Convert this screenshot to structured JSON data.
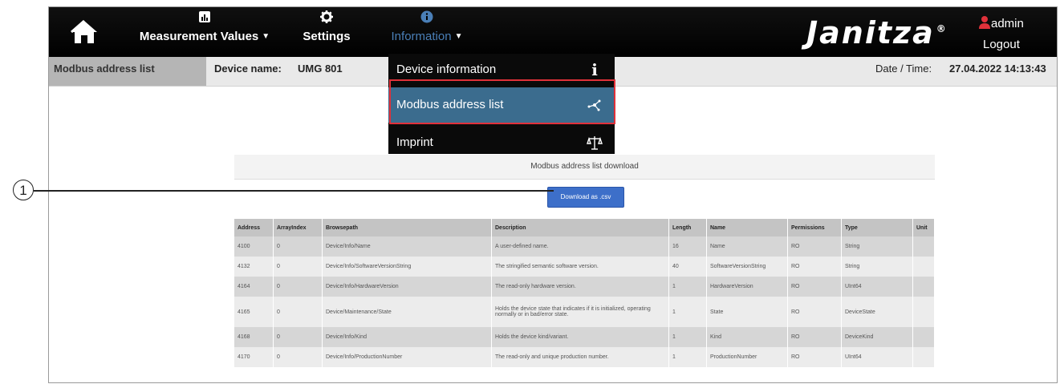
{
  "nav": {
    "measurement_label": "Measurement Values",
    "settings_label": "Settings",
    "information_label": "Information"
  },
  "brand": {
    "name": "Janitza",
    "mark": "®"
  },
  "user": {
    "name": "admin",
    "logout": "Logout"
  },
  "subbar": {
    "breadcrumb": "Modbus address list",
    "device_name_label": "Device name:",
    "device_name_value": "UMG 801",
    "datetime_label": "Date / Time:",
    "datetime_value": "27.04.2022 14:13:43"
  },
  "dropdown": {
    "items": [
      {
        "label": "Device information",
        "icon": "info-icon",
        "selected": false
      },
      {
        "label": "Modbus address list",
        "icon": "network-icon",
        "selected": true
      },
      {
        "label": "Imprint",
        "icon": "scales-icon",
        "selected": false
      }
    ]
  },
  "panel": {
    "title": "Modbus address list download",
    "download_button": "Download as .csv"
  },
  "table": {
    "headers": [
      "Address",
      "ArrayIndex",
      "Browsepath",
      "Description",
      "Length",
      "Name",
      "Permissions",
      "Type",
      "Unit"
    ],
    "rows": [
      [
        "4100",
        "0",
        "Device/Info/Name",
        "A user-defined name.",
        "16",
        "Name",
        "RO",
        "String",
        ""
      ],
      [
        "4132",
        "0",
        "Device/Info/SoftwareVersionString",
        "The stringified semantic software version.",
        "40",
        "SoftwareVersionString",
        "RO",
        "String",
        ""
      ],
      [
        "4164",
        "0",
        "Device/Info/HardwareVersion",
        "The read-only hardware version.",
        "1",
        "HardwareVersion",
        "RO",
        "UInt64",
        ""
      ],
      [
        "4165",
        "0",
        "Device/Maintenance/State",
        "Holds the device state that indicates if it is initialized, operating normally or in bad/error state.",
        "1",
        "State",
        "RO",
        "DeviceState",
        ""
      ],
      [
        "4168",
        "0",
        "Device/Info/Kind",
        "Holds the device kind/variant.",
        "1",
        "Kind",
        "RO",
        "DeviceKind",
        ""
      ],
      [
        "4170",
        "0",
        "Device/Info/ProductionNumber",
        "The read-only and unique production number.",
        "1",
        "ProductionNumber",
        "RO",
        "UInt64",
        ""
      ]
    ]
  },
  "callout": {
    "number": "1"
  },
  "colors": {
    "topbar": "#000000",
    "info_accent": "#4a7fb7",
    "selected_item": "#3b6c8e",
    "highlight_border": "#e0313a",
    "download_button": "#3d6fc9",
    "user_icon": "#e0313a"
  }
}
